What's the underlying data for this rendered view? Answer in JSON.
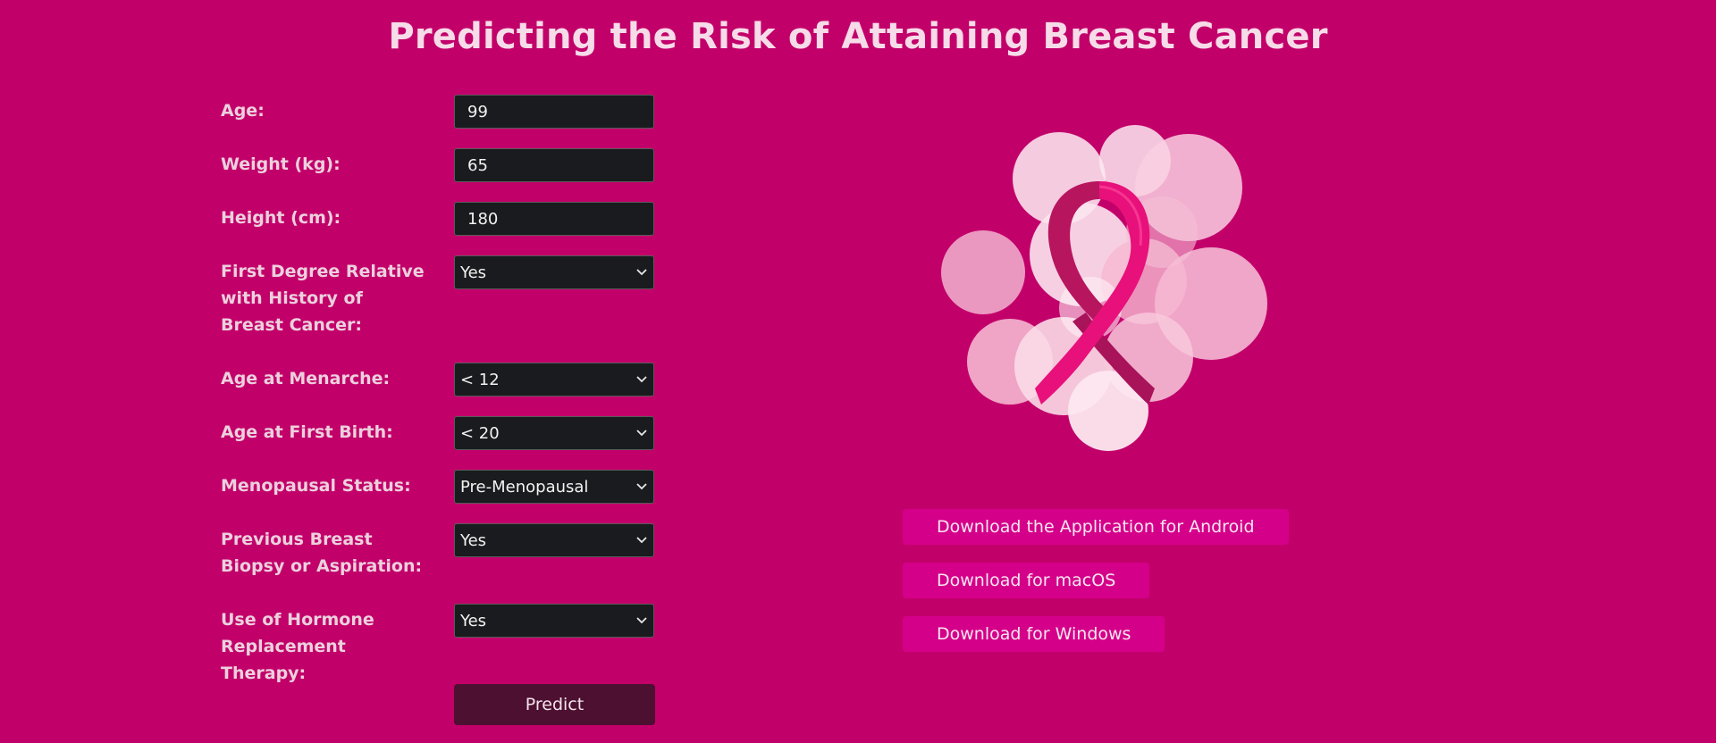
{
  "page": {
    "title": "Predicting the Risk of Attaining Breast Cancer"
  },
  "form": {
    "age": {
      "label": "Age:",
      "value": "99"
    },
    "weight": {
      "label": "Weight (kg):",
      "value": "65"
    },
    "height": {
      "label": "Height (cm):",
      "value": "180"
    },
    "family_history": {
      "label": "First Degree Relative with History of Breast Cancer:",
      "value": "Yes"
    },
    "menarche": {
      "label": "Age at Menarche:",
      "value": "< 12"
    },
    "first_birth": {
      "label": "Age at First Birth:",
      "value": "< 20"
    },
    "menopause": {
      "label": "Menopausal Status:",
      "value": "Pre-Menopausal"
    },
    "biopsy": {
      "label": "Previous Breast Biopsy or Aspiration:",
      "value": "Yes"
    },
    "hrt": {
      "label": "Use of Hormone Replacement Therapy:",
      "value": "Yes"
    },
    "predict_label": "Predict"
  },
  "downloads": {
    "android": "Download the Application for Android",
    "macos": "Download for macOS",
    "windows": "Download for Windows"
  },
  "icons": {
    "select_chevron": "chevron-down-icon",
    "illustration": "pink-ribbon-icon"
  },
  "colors": {
    "background": "#c2006a",
    "title": "#f6dbe8",
    "field_bg": "#1a1b1e",
    "predict_button": "#4d1030",
    "download_button": "#d5008a",
    "ribbon": "#e8107a"
  }
}
